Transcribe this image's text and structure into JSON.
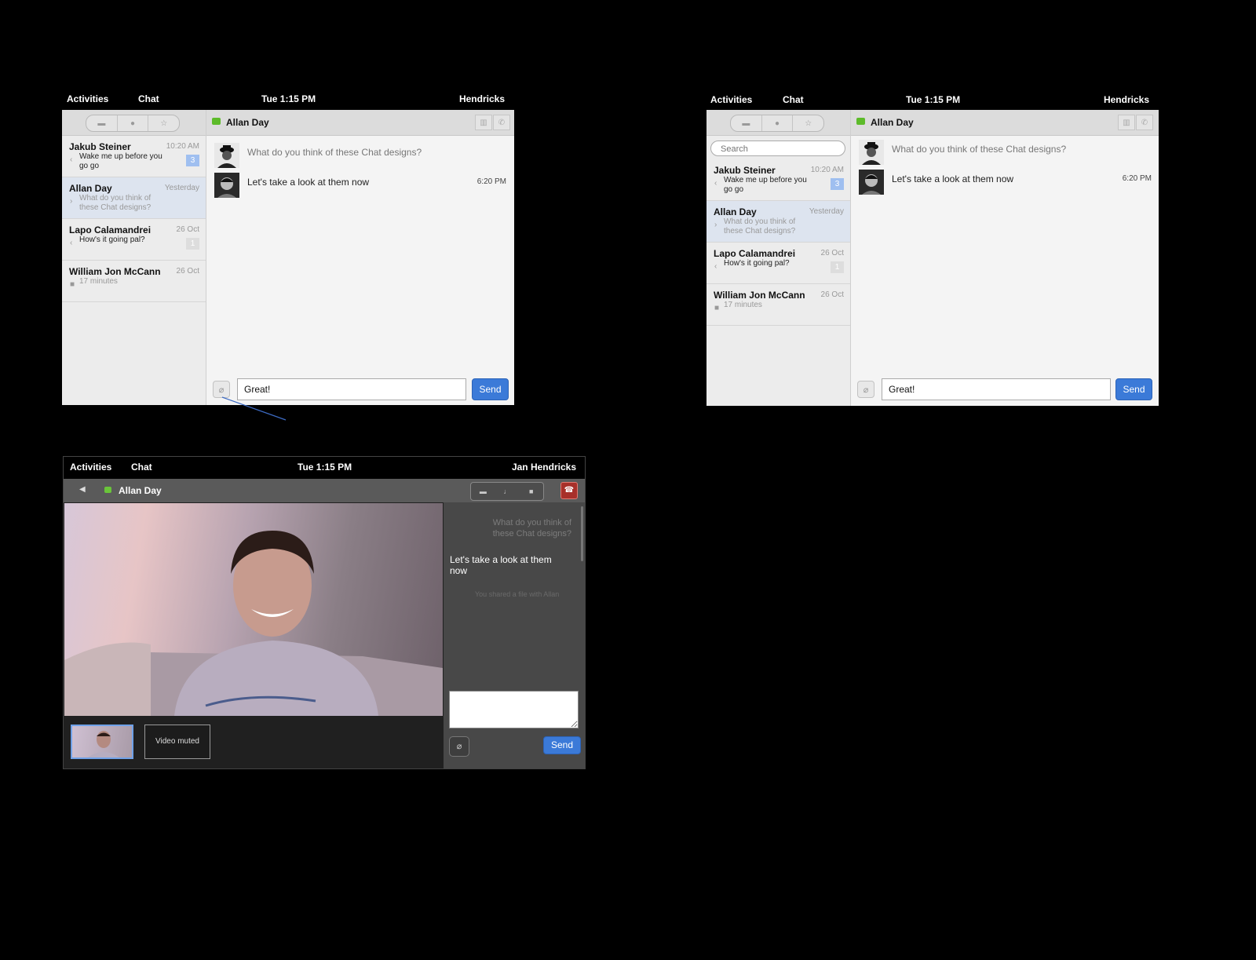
{
  "topbar": {
    "activities": "Activities",
    "app": "Chat",
    "clock": "Tue 1:15 PM",
    "user": "Hendricks",
    "user_full": "Jan Hendricks"
  },
  "conversation": {
    "title": "Allan Day",
    "messages": [
      {
        "text": "What do you think of these Chat designs?",
        "time": ""
      },
      {
        "text": "Let's take a look at them now",
        "time": "6:20 PM"
      }
    ]
  },
  "contacts": [
    {
      "name": "Jakub Steiner",
      "time": "10:20 AM",
      "preview": "Wake me up before you go go",
      "badge": "3",
      "selected": false
    },
    {
      "name": "Allan Day",
      "time": "Yesterday",
      "preview": "What do you think of these Chat designs?",
      "badge": "",
      "selected": true
    },
    {
      "name": "Lapo Calamandrei",
      "time": "26 Oct",
      "preview": "How's it going pal?",
      "badge": "1",
      "selected": false
    },
    {
      "name": "William Jon McCann",
      "time": "26 Oct",
      "preview": "17 minutes",
      "badge": "",
      "selected": false
    }
  ],
  "search": {
    "placeholder": "Search"
  },
  "compose": {
    "value": "Great!",
    "send_label": "Send"
  },
  "video_call": {
    "title": "Allan Day",
    "thumb_label": "Video muted",
    "chat": {
      "incoming": "What do you think of these Chat designs?",
      "outgoing": "Let's take a look at them now",
      "event": "You shared a file with Allan"
    },
    "send_label": "Send"
  },
  "colors": {
    "accent": "#3b7ad8",
    "selection": "#dde4ef",
    "presence": "#5dbb2a",
    "hangup": "#a8302a",
    "badge": "#9fbff0"
  }
}
